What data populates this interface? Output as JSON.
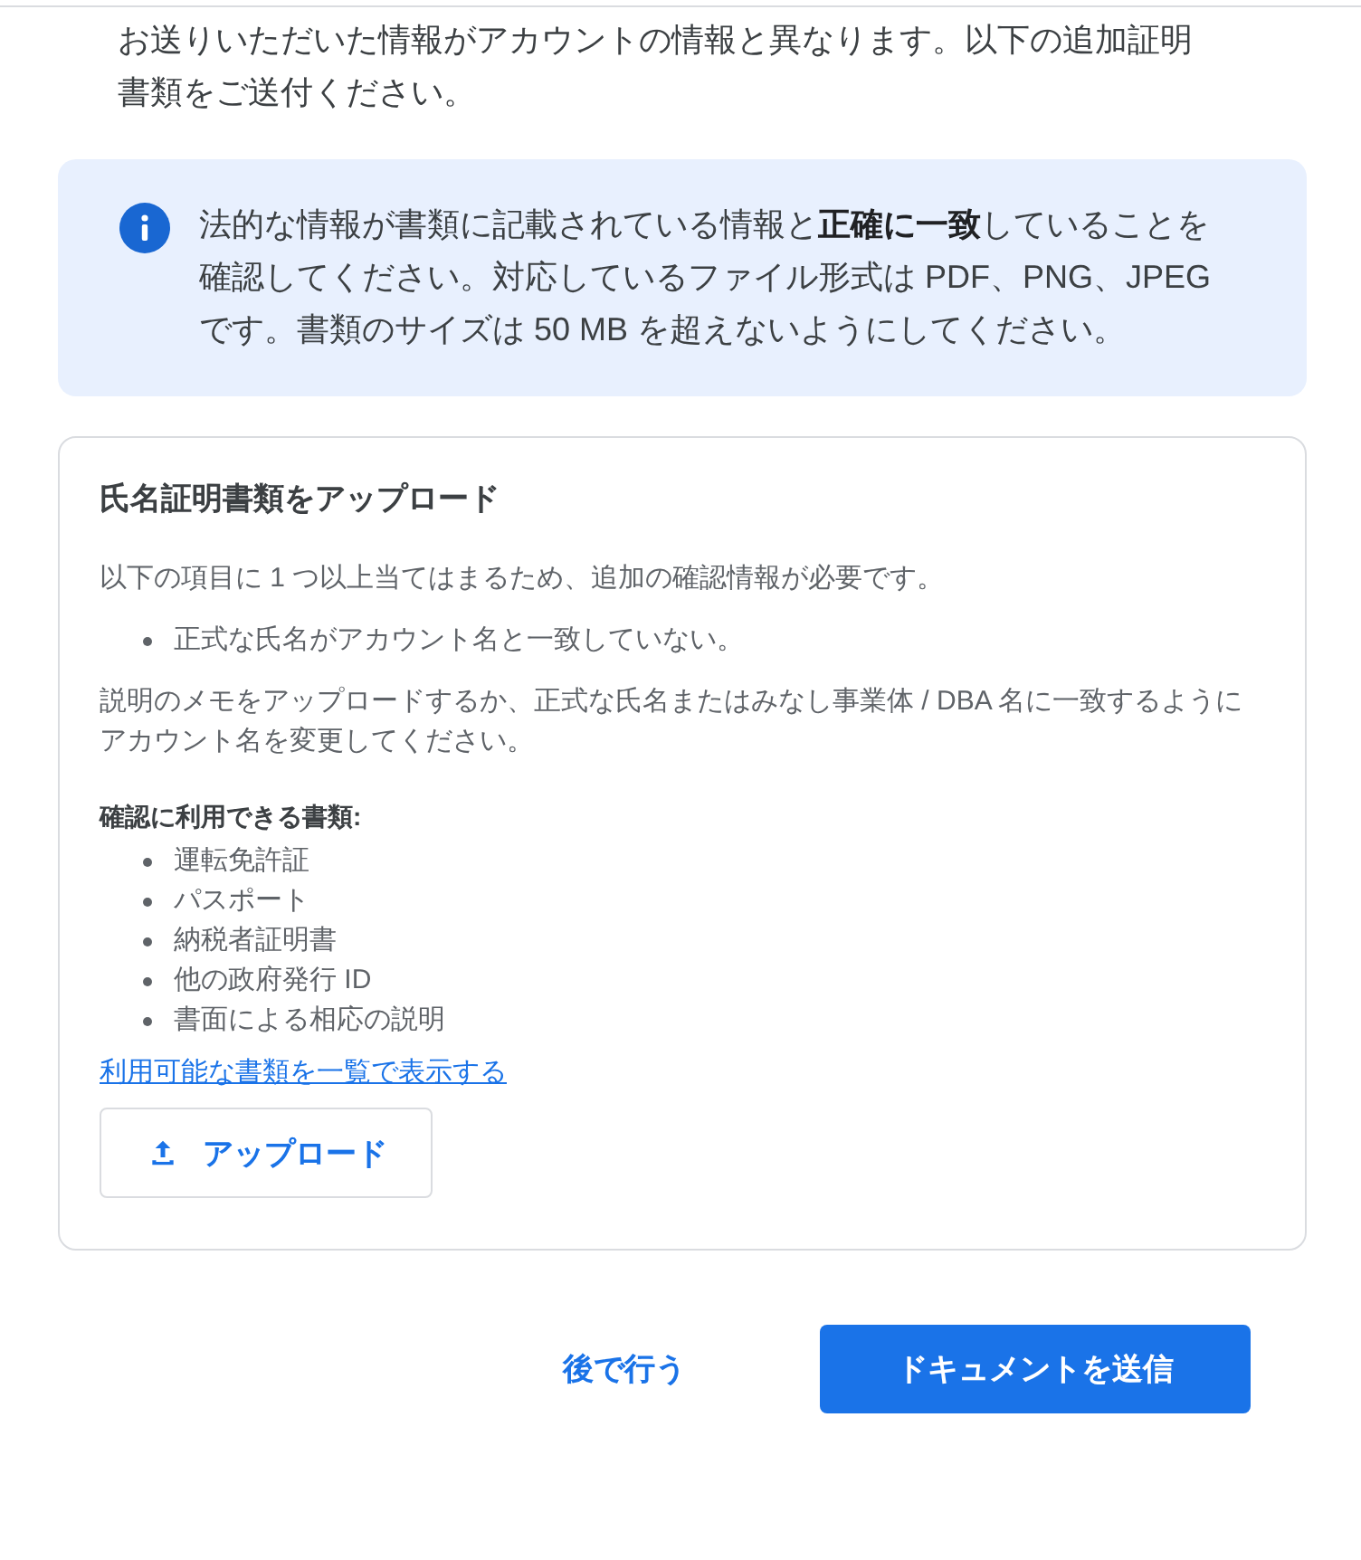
{
  "intro": "お送りいただいた情報がアカウントの情報と異なります。以下の追加証明書類をご送付ください。",
  "notice": "法的な情報が書類に記載されている情報と**正確に一致**していることを確認してください。対応しているファイル形式は PDF、PNG、JPEG です。書類のサイズは 50 MB を超えないようにしてください。",
  "card": {
    "title": "氏名証明書類をアップロード",
    "reason": "以下の項目に 1 つ以上当てはまるため、追加の確認情報が必要です。",
    "reasons": [
      "正式な氏名がアカウント名と一致していない。"
    ],
    "instruction": "説明のメモをアップロードするか、正式な氏名またはみなし事業体 / DBA 名に一致するようにアカウント名を変更してください。",
    "documents_label": "確認に利用できる書類:",
    "documents": [
      "運転免許証",
      "パスポート",
      "納税者証明書",
      "他の政府発行 ID",
      "書面による相応の説明"
    ],
    "link": "利用可能な書類を一覧で表示する",
    "upload_button": "アップロード"
  },
  "actions": {
    "secondary": "後で行う",
    "primary": "ドキュメントを送信"
  }
}
